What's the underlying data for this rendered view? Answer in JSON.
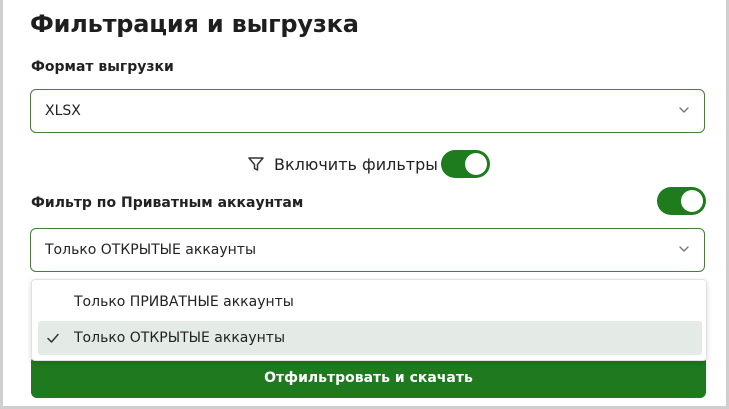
{
  "panel": {
    "title": "Фильтрация и выгрузка"
  },
  "export_format": {
    "label": "Формат выгрузки",
    "selected": "XLSX"
  },
  "filters_toggle": {
    "label": "Включить фильтры",
    "enabled": true
  },
  "private_filter": {
    "label": "Фильтр по Приватным аккаунтам",
    "enabled": true,
    "selected": "Только ОТКРЫТЫЕ аккаунты",
    "options": [
      {
        "label": "Только ПРИВАТНЫЕ аккаунты",
        "selected": false
      },
      {
        "label": "Только ОТКРЫТЫЕ аккаунты",
        "selected": true
      }
    ]
  },
  "submit": {
    "label": "Отфильтровать и скачать"
  },
  "colors": {
    "accent": "#1e7b1e",
    "border": "#4a7a3c",
    "selected_option_bg": "#e4ebe6"
  },
  "icons": {
    "filter": "filter-funnel-icon",
    "chevron": "chevron-down-icon",
    "check": "check-icon"
  }
}
